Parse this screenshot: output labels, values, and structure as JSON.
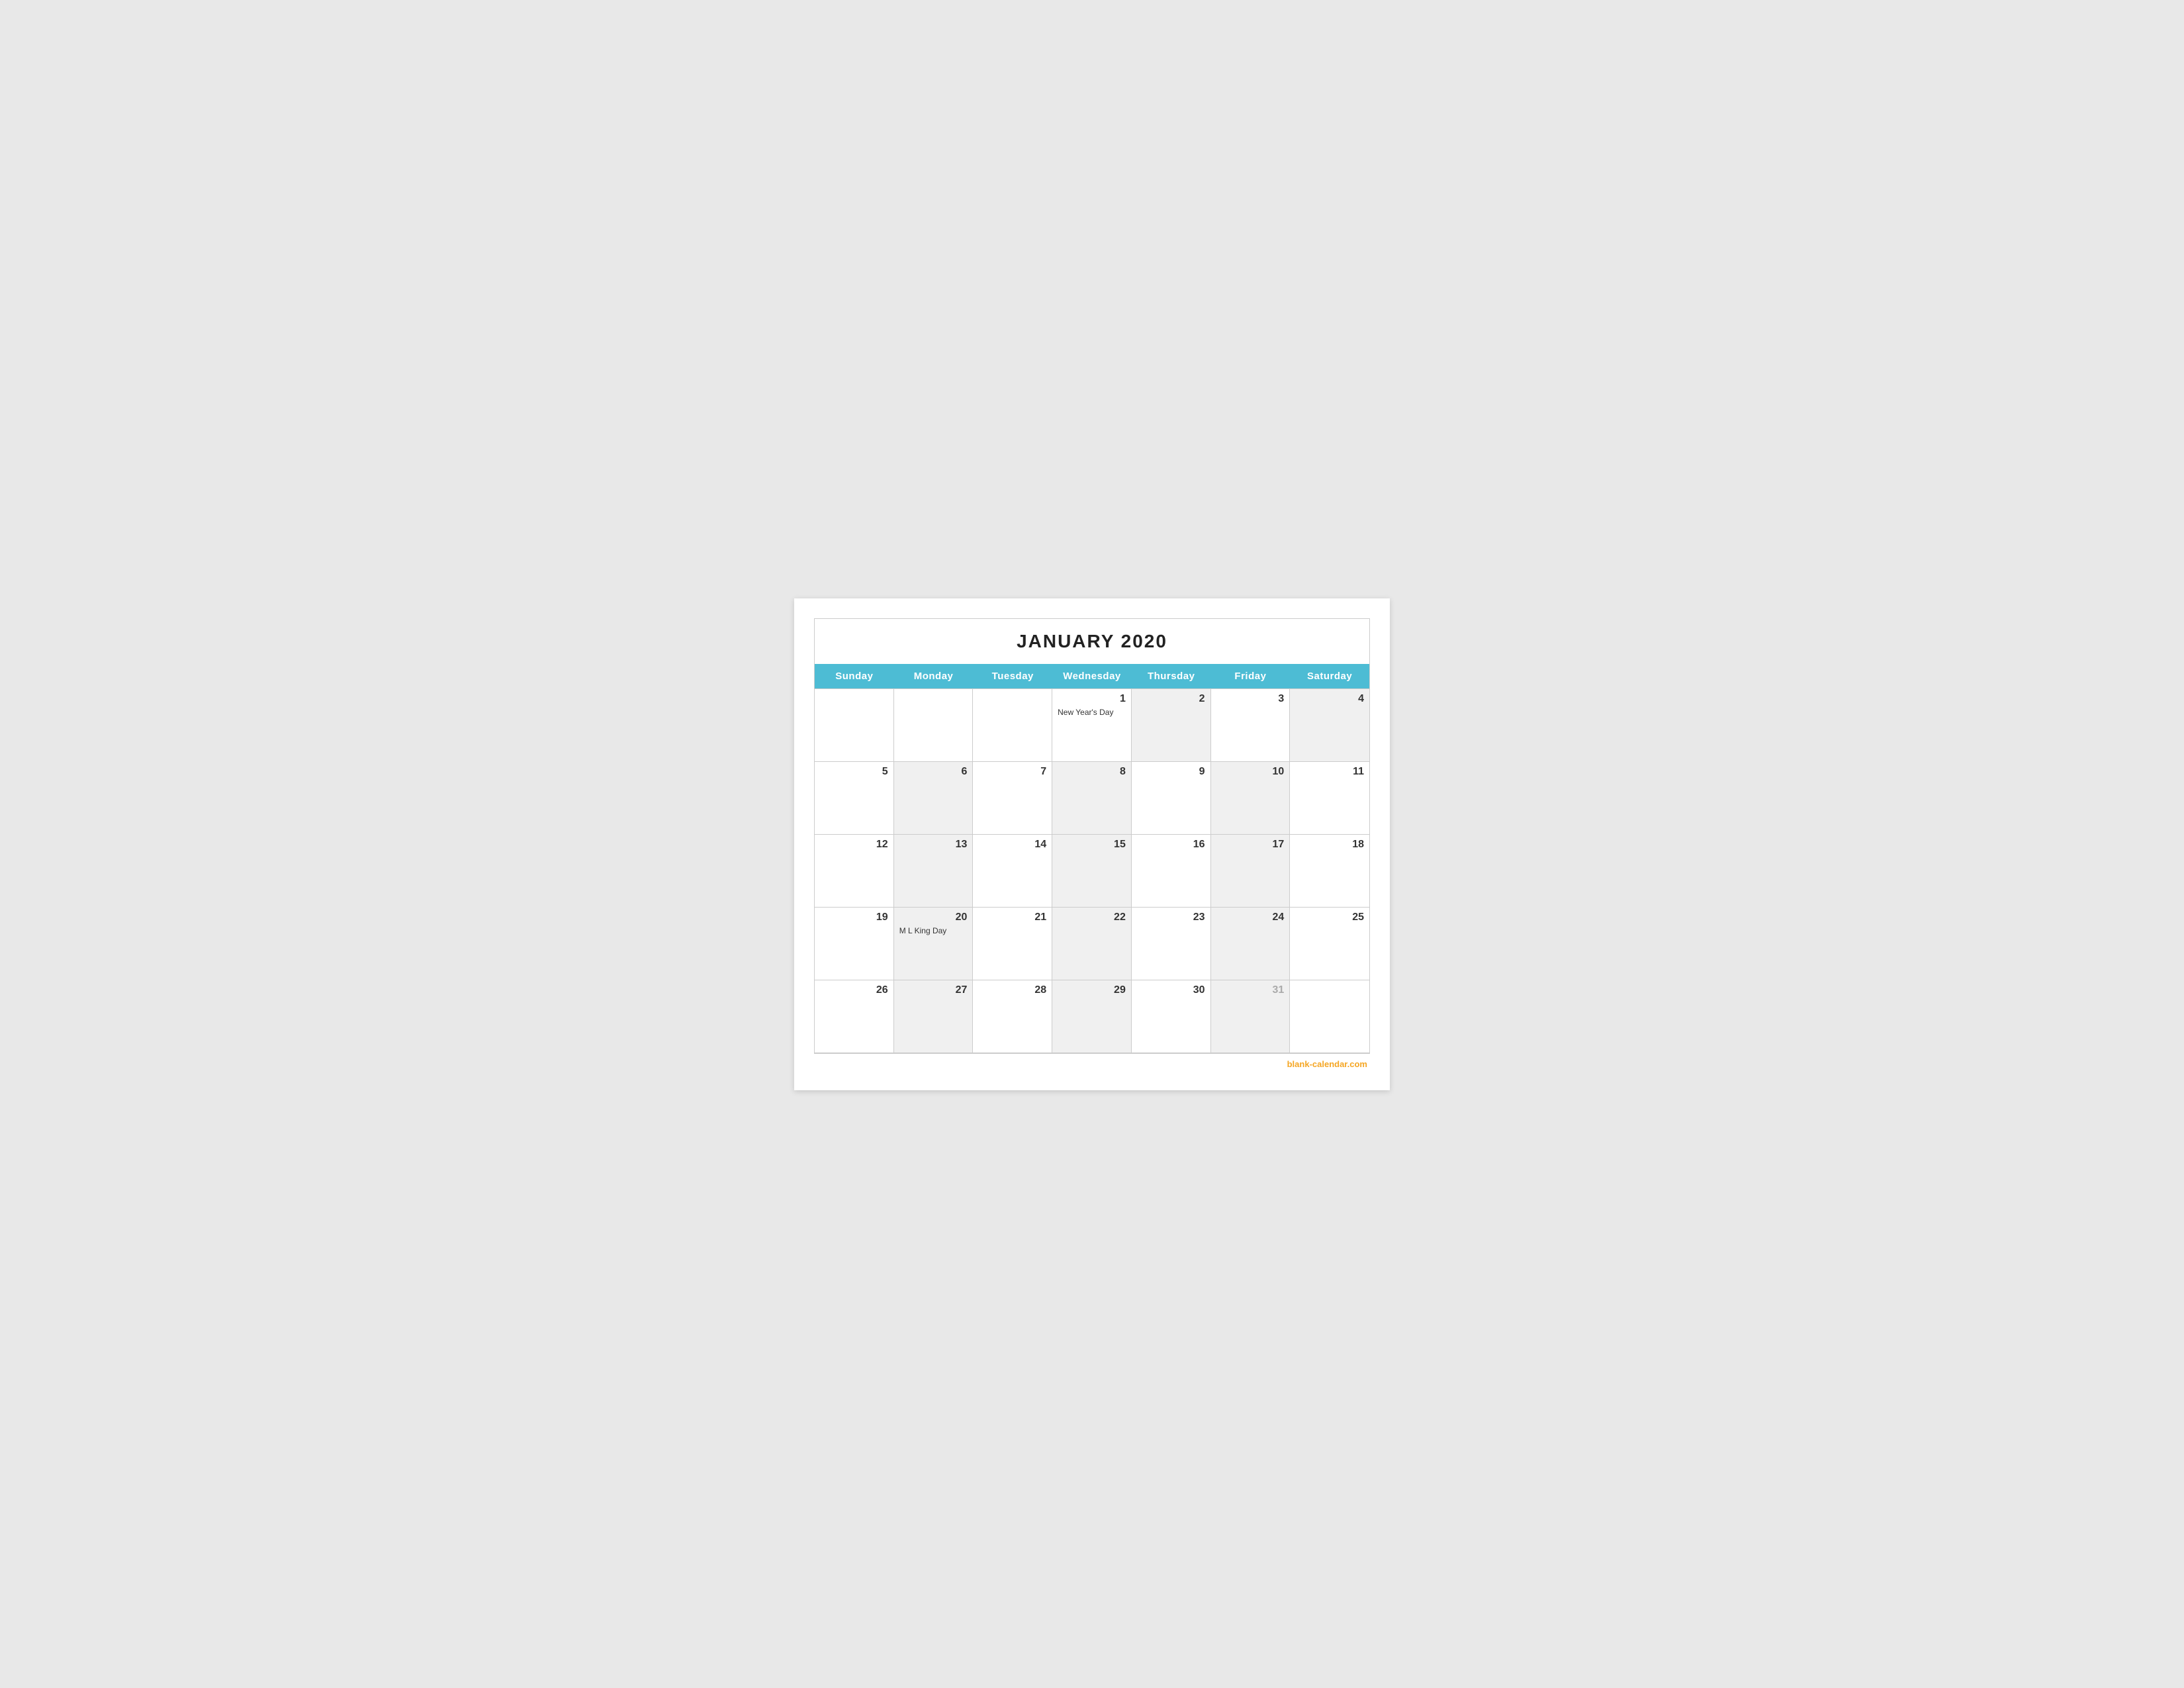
{
  "calendar": {
    "title": "JANUARY 2020",
    "headers": [
      "Sunday",
      "Monday",
      "Tuesday",
      "Wednesday",
      "Thursday",
      "Friday",
      "Saturday"
    ],
    "weeks": [
      [
        {
          "day": "",
          "shaded": false,
          "event": ""
        },
        {
          "day": "",
          "shaded": false,
          "event": ""
        },
        {
          "day": "",
          "shaded": false,
          "event": ""
        },
        {
          "day": "1",
          "shaded": false,
          "event": "New Year's Day"
        },
        {
          "day": "2",
          "shaded": true,
          "event": ""
        },
        {
          "day": "3",
          "shaded": false,
          "event": ""
        },
        {
          "day": "4",
          "shaded": true,
          "event": ""
        }
      ],
      [
        {
          "day": "5",
          "shaded": false,
          "event": ""
        },
        {
          "day": "6",
          "shaded": true,
          "event": ""
        },
        {
          "day": "7",
          "shaded": false,
          "event": ""
        },
        {
          "day": "8",
          "shaded": true,
          "event": ""
        },
        {
          "day": "9",
          "shaded": false,
          "event": ""
        },
        {
          "day": "10",
          "shaded": true,
          "event": ""
        },
        {
          "day": "11",
          "shaded": false,
          "event": ""
        }
      ],
      [
        {
          "day": "12",
          "shaded": false,
          "event": ""
        },
        {
          "day": "13",
          "shaded": true,
          "event": ""
        },
        {
          "day": "14",
          "shaded": false,
          "event": ""
        },
        {
          "day": "15",
          "shaded": true,
          "event": ""
        },
        {
          "day": "16",
          "shaded": false,
          "event": ""
        },
        {
          "day": "17",
          "shaded": true,
          "event": ""
        },
        {
          "day": "18",
          "shaded": false,
          "event": ""
        }
      ],
      [
        {
          "day": "19",
          "shaded": false,
          "event": ""
        },
        {
          "day": "20",
          "shaded": true,
          "event": "M L King Day"
        },
        {
          "day": "21",
          "shaded": false,
          "event": ""
        },
        {
          "day": "22",
          "shaded": true,
          "event": ""
        },
        {
          "day": "23",
          "shaded": false,
          "event": ""
        },
        {
          "day": "24",
          "shaded": true,
          "event": ""
        },
        {
          "day": "25",
          "shaded": false,
          "event": ""
        }
      ],
      [
        {
          "day": "26",
          "shaded": false,
          "event": ""
        },
        {
          "day": "27",
          "shaded": true,
          "event": ""
        },
        {
          "day": "28",
          "shaded": false,
          "event": ""
        },
        {
          "day": "29",
          "shaded": true,
          "event": ""
        },
        {
          "day": "30",
          "shaded": false,
          "event": ""
        },
        {
          "day": "31",
          "shaded": true,
          "event": "",
          "muted": true
        },
        {
          "day": "",
          "shaded": false,
          "event": ""
        }
      ]
    ],
    "watermark": "blank-calendar.com"
  }
}
